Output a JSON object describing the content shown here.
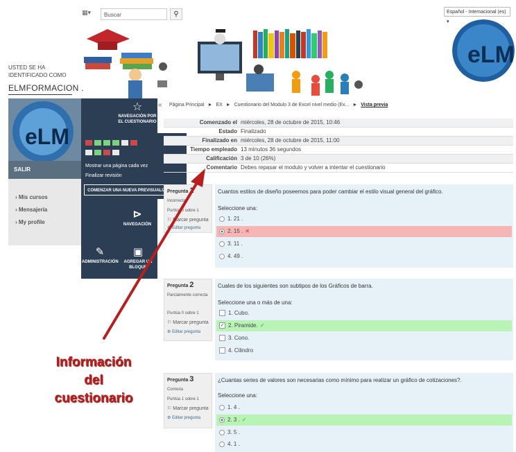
{
  "header": {
    "search_placeholder": "Buscar",
    "language": "Español - Internacional (es)",
    "logged_in_text": "USTED SE HA IDENTIFICADO COMO",
    "username": "ELMFORMACION .",
    "grid_icon": "grid-icon"
  },
  "sidebar": {
    "salir": "SALIR",
    "links": [
      "Mis cursos",
      "Mensajería",
      "My profile"
    ]
  },
  "nav": {
    "quiz_nav": "NAVEGACIÓN POR EL CUESTIONARIO",
    "show_one_page": "Mostrar una página cada vez",
    "finish_review": "Finalizar revisión",
    "new_preview": "COMENZAR UNA NUEVA PREVISUALIZACIÓN",
    "navegacion": "NAVEGACIÓN",
    "administracion": "ADMINISTRACIÓN",
    "add_block": "AGREGAR UN BLOQUE",
    "collapse": "«",
    "nav_colors": [
      "#c94a4a",
      "#7fd07f",
      "#7fd07f",
      "#7fd07f",
      "#e8e8e8",
      "#c94a4a"
    ]
  },
  "breadcrumb": {
    "items": [
      "Página Principal",
      "EX",
      "Cuestionario del Modulo 3 de Excel nivel medio (Ex...",
      "Vista previa"
    ],
    "separator": "►"
  },
  "summary": [
    {
      "label": "Comenzado el",
      "value": "miércoles, 28 de octubre de 2015, 10:46"
    },
    {
      "label": "Estado",
      "value": "Finalizado"
    },
    {
      "label": "Finalizado en",
      "value": "miércoles, 28 de octubre de 2015, 11:00"
    },
    {
      "label": "Tiempo empleado",
      "value": "13 minutos 36 segundos"
    },
    {
      "label": "Calificación",
      "value": "3 de 10 (26%)"
    },
    {
      "label": "Comentario",
      "value": "Debes repasar el modulo y volver a intentar el cuestionario"
    }
  ],
  "questions": [
    {
      "title": "Pregunta",
      "number": "1",
      "state": "Incorrecta",
      "points": "Puntúa 0 sobre 1",
      "flag": "Marcar pregunta",
      "edit": "Editar pregunta",
      "text": "Cuantos estilos de diseño poseemos para poder cambiar el estilo visual general del gráfico.",
      "prompt": "Seleccione una:",
      "options": [
        "1. 21 .",
        "2. 15 .",
        "3. 11 .",
        "4. 49 ."
      ]
    },
    {
      "title": "Pregunta",
      "number": "2",
      "state": "Parcialmente correcta",
      "points": "Puntúa 0 sobre 1",
      "flag": "Marcar pregunta",
      "edit": "Editar pregunta",
      "text": "Cuales de los siguientes son subtipos de los Gráficos de barra.",
      "prompt": "Seleccione una o más de una:",
      "options": [
        "1. Cubo.",
        "2. Piramide.",
        "3. Cono.",
        "4. Cilindro"
      ]
    },
    {
      "title": "Pregunta",
      "number": "3",
      "state": "Correcta",
      "points": "Puntúa 1 sobre 1",
      "flag": "Marcar pregunta",
      "edit": "Editar pregunta",
      "text": "¿Cuantas series de valores son necesarias como mínimo para realizar un gráfico de cotizaciones?.",
      "prompt": "Seleccione una:",
      "options": [
        "1. 4 .",
        "2. 3 .",
        "3. 5 .",
        "4. 1 ."
      ]
    }
  ],
  "annotation": [
    "Información",
    "del",
    "cuestionario"
  ],
  "colors": {
    "nav_dark": "#2c3e54",
    "correct": "#b9f3b5",
    "incorrect": "#f6b6b6",
    "question_bg": "#e7f1f8",
    "annotation": "#b82020"
  }
}
